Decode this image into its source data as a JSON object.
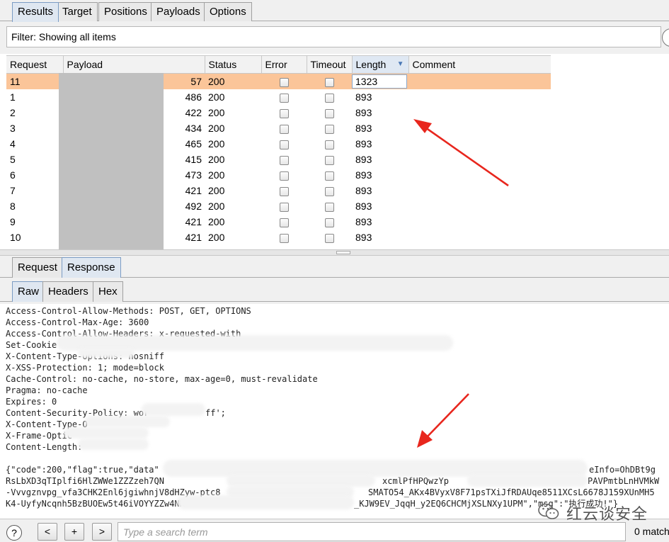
{
  "top_tabs": [
    "Results",
    "Target",
    "Positions",
    "Payloads",
    "Options"
  ],
  "active_top_tab": "Results",
  "filter": {
    "text": "Filter: Showing all items"
  },
  "table": {
    "columns": [
      "Request",
      "Payload",
      "Status",
      "Error",
      "Timeout",
      "Length",
      "Comment"
    ],
    "sorted_column": "Length",
    "rows": [
      {
        "request": "11",
        "payload": "57",
        "status": "200",
        "length": "1323",
        "selected": true
      },
      {
        "request": "1",
        "payload": "486",
        "status": "200",
        "length": "893"
      },
      {
        "request": "2",
        "payload": "422",
        "status": "200",
        "length": "893"
      },
      {
        "request": "3",
        "payload": "434",
        "status": "200",
        "length": "893"
      },
      {
        "request": "4",
        "payload": "465",
        "status": "200",
        "length": "893"
      },
      {
        "request": "5",
        "payload": "415",
        "status": "200",
        "length": "893"
      },
      {
        "request": "6",
        "payload": "473",
        "status": "200",
        "length": "893"
      },
      {
        "request": "7",
        "payload": "421",
        "status": "200",
        "length": "893"
      },
      {
        "request": "8",
        "payload": "492",
        "status": "200",
        "length": "893"
      },
      {
        "request": "9",
        "payload": "421",
        "status": "200",
        "length": "893"
      },
      {
        "request": "10",
        "payload": "421",
        "status": "200",
        "length": "893"
      }
    ]
  },
  "detail_tabs": [
    "Request",
    "Response"
  ],
  "active_detail_tab": "Response",
  "view_tabs": [
    "Raw",
    "Headers",
    "Hex"
  ],
  "active_view_tab": "Raw",
  "response_lines": [
    "Access-Control-Allow-Methods: POST, GET, OPTIONS",
    "Access-Control-Max-Age: 3600",
    "Access-Control-Allow-Headers: x-requested-with",
    "Set-Cookie",
    "X-Content-Type-Options: nosniff",
    "X-XSS-Protection: 1; mode=block",
    "Cache-Control: no-cache, no-store, max-age=0, must-revalidate",
    "Pragma: no-cache",
    "Expires: 0",
    "Content-Security-Policy: wor",
    "X-Content-Type-O",
    "X-Frame-Optic",
    "Content-Length:",
    "",
    "{\"code\":200,\"flag\":true,\"data\"",
    "RsLbXD3qTIplfi6HlZWWe1ZZZzeh7QN",
    "-Vvvgznvpg_vfa3CHK2Enl6jgiwhnjV8dHZyw-ptc8",
    "K4-UyfyNcqnh5BzBUOEw5t46iVOYYZZw4NK"
  ],
  "response_fragments": {
    "csp_tail": "ff';",
    "line1_tail": "eInfo=OhDBt9g",
    "line2_mid": "xcmlPfHPQwzYp",
    "line2_tail": "PAVPmtbLnHVMkW",
    "line3_mid": "SMATO54_AKx4BVyxV8F71psTXiJfRDAUqe8511XCsL6678J159XUnMH5",
    "line4_tail": "_KJW9EV_JqqH_y2EQ6CHCMjXSLNXy1UPM\",\"msg\":\"执行成功!\"}"
  },
  "bottom_bar": {
    "help": "?",
    "prev": "<",
    "add": "+",
    "next": ">",
    "search_placeholder": "Type a search term",
    "matches": "0 match"
  },
  "watermark": {
    "text": "红云谈安全",
    "logo": "wechat-logo-icon"
  },
  "annotation_color": "#e8261d"
}
